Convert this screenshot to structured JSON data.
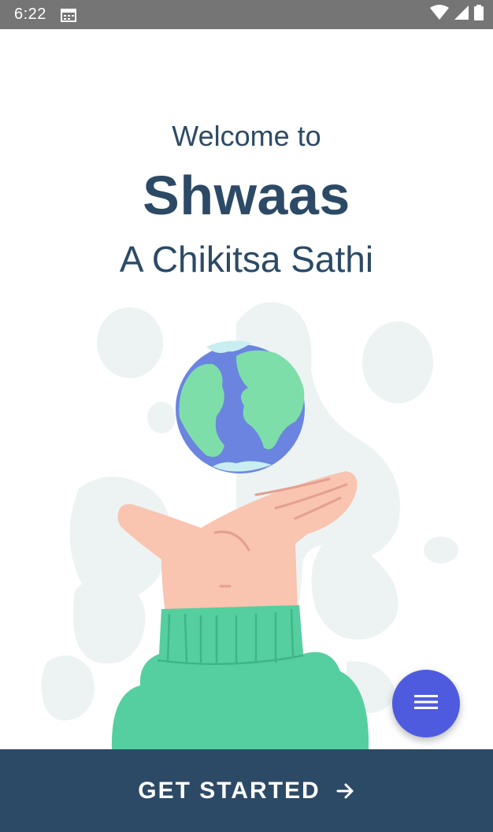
{
  "status_bar": {
    "time": "6:22",
    "icons": [
      "calendar-icon",
      "wifi-icon",
      "cell-signal-icon",
      "battery-icon"
    ]
  },
  "welcome": {
    "line1": "Welcome to",
    "title": "Shwaas",
    "tagline": "A Chikitsa Sathi"
  },
  "illustration": {
    "icon": "hand-holding-globe-illustration"
  },
  "fab": {
    "icon": "menu-icon"
  },
  "cta": {
    "label": "GET STARTED",
    "icon": "arrow-right-icon"
  },
  "colors": {
    "primary_dark": "#2c4a66",
    "accent": "#4e5bde",
    "status_bar": "#757575",
    "blob": "#edf3f3",
    "sweater": "#56cfa0",
    "skin": "#f9c4b0",
    "ocean": "#6b84e0",
    "land": "#7edeaa"
  }
}
